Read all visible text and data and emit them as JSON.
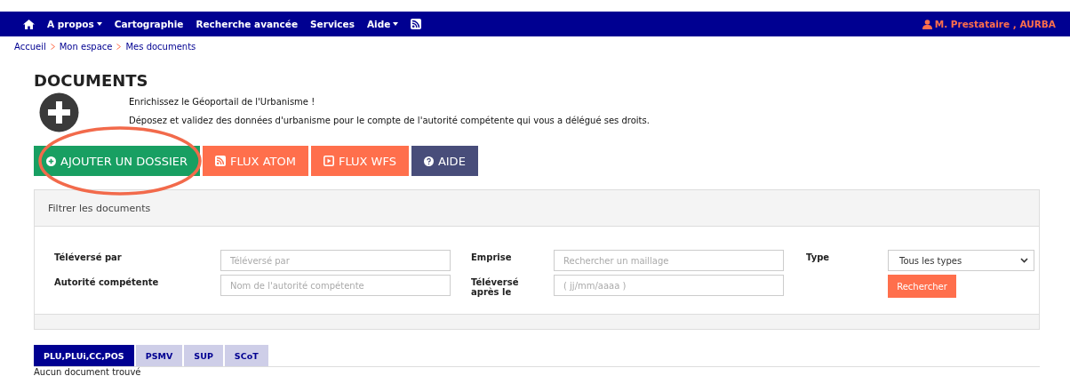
{
  "navbar": {
    "items": [
      {
        "kind": "home"
      },
      {
        "kind": "menu",
        "label": "A propos"
      },
      {
        "kind": "link",
        "label": "Cartographie"
      },
      {
        "kind": "link",
        "label": "Recherche avancée"
      },
      {
        "kind": "link",
        "label": "Services"
      },
      {
        "kind": "menu",
        "label": "Aide"
      },
      {
        "kind": "rss"
      }
    ],
    "user": "M. Prestataire , AURBA"
  },
  "breadcrumb": [
    "Accueil",
    "Mon espace",
    "Mes documents"
  ],
  "title": "DOCUMENTS",
  "intro": [
    "Enrichissez le Géoportail de l'Urbanisme !",
    "Déposez et validez des données d'urbanisme pour le compte de l'autorité compétente qui vous a délégué ses droits."
  ],
  "actions": [
    {
      "kind": "add",
      "label": "AJOUTER UN DOSSIER",
      "color": "#189f62"
    },
    {
      "kind": "rss",
      "label": "FLUX ATOM",
      "color": "#ff6f4c"
    },
    {
      "kind": "play",
      "label": "FLUX WFS",
      "color": "#ff6f4c"
    },
    {
      "kind": "help",
      "label": "AIDE",
      "color": "#484d7a"
    }
  ],
  "annotation": {
    "kind": "ellipse"
  },
  "filter": {
    "title": "Filtrer les documents",
    "fields": [
      {
        "label": "Téléversé par",
        "placeholder": "Téléversé par"
      },
      {
        "label": "Emprise",
        "placeholder": "Rechercher un maillage"
      },
      {
        "label": "Autorité compétente",
        "placeholder": "Nom de l'autorité compétente"
      },
      {
        "label": "Téléversé après le",
        "placeholder": "( jj/mm/aaaa )"
      }
    ],
    "type": {
      "label": "Type",
      "value": "Tous les types"
    },
    "search_button": "Rechercher"
  },
  "tabs": [
    {
      "label": "PLU,PLUi,CC,POS",
      "selected": true
    },
    {
      "label": "PSMV",
      "selected": false
    },
    {
      "label": "SUP",
      "selected": false
    },
    {
      "label": "SCoT",
      "selected": false
    }
  ],
  "empty_message": "Aucun document trouvé"
}
